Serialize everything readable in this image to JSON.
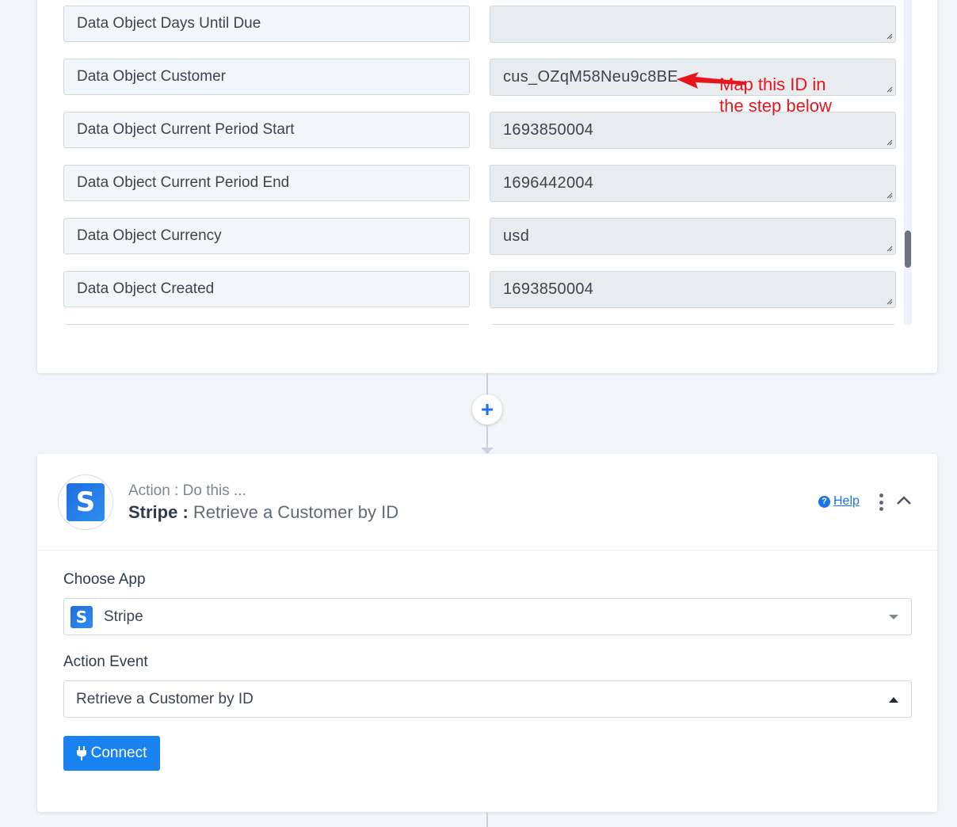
{
  "trigger_fields": [
    {
      "key": "Data Object Days Until Due",
      "value": ""
    },
    {
      "key": "Data Object Customer",
      "value": "cus_OZqM58Neu9c8BE"
    },
    {
      "key": "Data Object Current Period Start",
      "value": "1693850004"
    },
    {
      "key": "Data Object Current Period End",
      "value": "1696442004"
    },
    {
      "key": "Data Object Currency",
      "value": "usd"
    },
    {
      "key": "Data Object Created",
      "value": "1693850004"
    }
  ],
  "annotation": {
    "line1": "Map this ID in",
    "line2": "the step below",
    "color": "#e8141c"
  },
  "connector": {
    "add_icon": "+"
  },
  "action": {
    "subtitle": "Action : Do this ...",
    "app_name": "Stripe :",
    "event_name": "Retrieve a Customer by ID",
    "logo_letter": "S",
    "help_label": "Help",
    "help_icon": "?"
  },
  "form": {
    "choose_app_label": "Choose App",
    "choose_app_value": "Stripe",
    "action_event_label": "Action Event",
    "action_event_value": "Retrieve a Customer by ID",
    "connect_label": "Connect"
  },
  "colors": {
    "accent": "#1a82f0",
    "link": "#1a73e8"
  }
}
